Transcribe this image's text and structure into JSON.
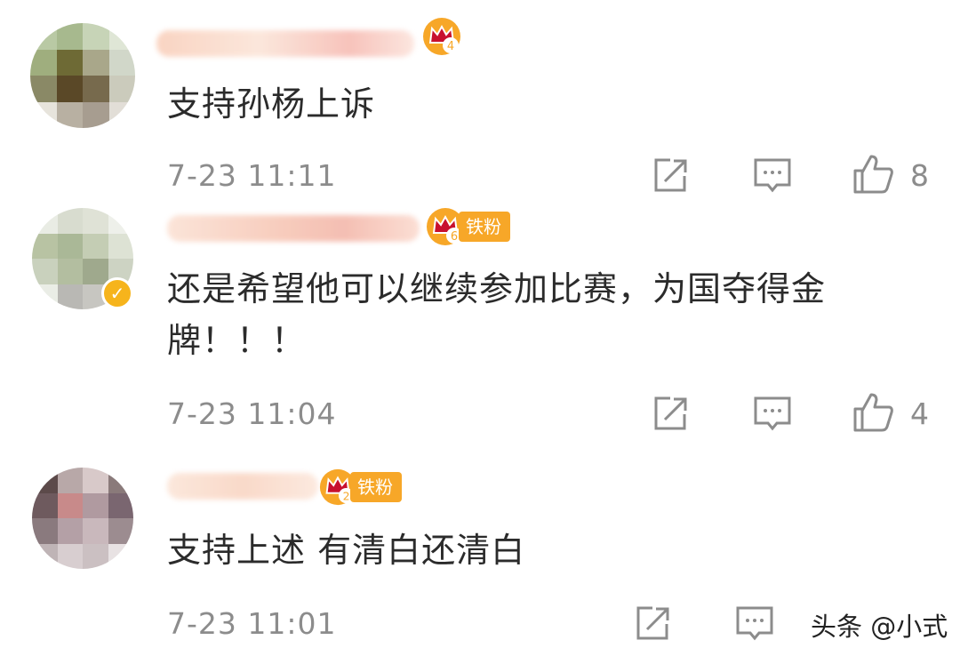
{
  "comments": [
    {
      "text": "支持孙杨上诉",
      "time": "7-23 11:11",
      "level": "4",
      "likes": "8",
      "avatar_colors": [
        "#b9c9a4",
        "#a7b98e",
        "#c7d4b7",
        "#dfe6d6",
        "#9fae7e",
        "#6e6a35",
        "#a9a78a",
        "#d1d7c9",
        "#8a8966",
        "#5a4827",
        "#776a4d",
        "#cbcbbc",
        "#e7e4dc",
        "#b8b0a2",
        "#a79d90",
        "#e2ded7"
      ]
    },
    {
      "text": "还是希望他可以继续参加比赛，为国夺得金牌！！！",
      "time": "7-23 11:04",
      "level": "6",
      "badge": "铁粉",
      "likes": "4",
      "avatar_colors": [
        "#e9ece4",
        "#d8dccf",
        "#dfe2d6",
        "#eef0ea",
        "#b8c3a3",
        "#aab897",
        "#c4cdb4",
        "#dde2d4",
        "#c9d1bd",
        "#b3bea0",
        "#9fa98d",
        "#cdd3c3",
        "#eaede6",
        "#b9b8b4",
        "#c7c6c1",
        "#f1f1ef"
      ],
      "verified": true
    },
    {
      "text": "支持上述 有清白还清白",
      "time": "7-23 11:01",
      "level": "2",
      "badge": "铁粉",
      "avatar_colors": [
        "#5c4a4a",
        "#b8a8a8",
        "#d8c9c9",
        "#8a7a7a",
        "#6e5a5e",
        "#c88a8a",
        "#b09aa0",
        "#7a6670",
        "#8a7a7e",
        "#b4a0a6",
        "#c9b8bc",
        "#9c8c90",
        "#bfb4b6",
        "#d8ced0",
        "#cbc0c2",
        "#e8e2e3"
      ]
    }
  ],
  "watermark": "头条 @小式",
  "colors": {
    "text": "#2b2b2b",
    "meta": "#8c8c8c",
    "gold": "#f7a728",
    "crown_red": "#c8102e"
  },
  "icons": [
    "share-icon",
    "comment-icon",
    "like-icon"
  ]
}
